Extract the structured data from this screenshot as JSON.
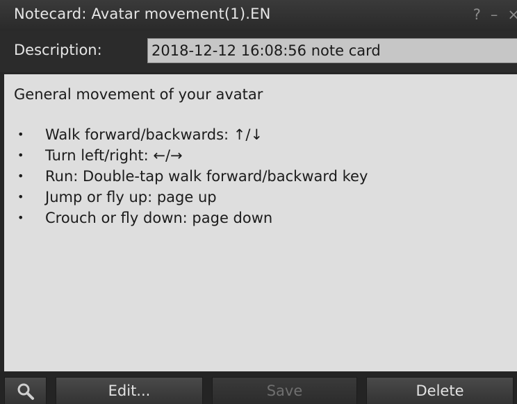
{
  "window": {
    "title": "Notecard: Avatar movement(1).EN",
    "help_glyph": "?",
    "minimize_glyph": "–",
    "close_glyph": "×"
  },
  "description": {
    "label": "Description:",
    "value": "2018-12-12 16:08:56 note card"
  },
  "notecard": {
    "heading": "General movement of your avatar",
    "bullet": "•",
    "items": [
      "Walk forward/backwards: ↑/↓",
      "Turn left/right: ←/→",
      "Run: Double-tap walk forward/backward key",
      "Jump or fly up: page up",
      "Crouch or fly down: page down"
    ]
  },
  "buttons": {
    "search_icon": "magnifier-icon",
    "edit": "Edit...",
    "save": "Save",
    "delete": "Delete"
  },
  "colors": {
    "window_bg": "#262626",
    "text_area_bg": "#dedede",
    "description_field_bg": "#c6c6c6",
    "disabled_text": "#6f6f6f"
  }
}
